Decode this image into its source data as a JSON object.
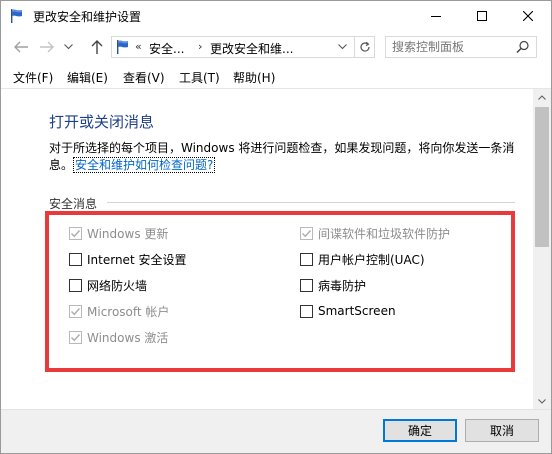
{
  "window": {
    "title": "更改安全和维护设置"
  },
  "nav": {
    "breadcrumb_prefix": "«",
    "breadcrumb_1": "安全...",
    "breadcrumb_sep": "›",
    "breadcrumb_2": "更改安全和维...",
    "search_placeholder": "搜索控制面板"
  },
  "menu": {
    "items": [
      {
        "label": "文件(F)"
      },
      {
        "label": "编辑(E)"
      },
      {
        "label": "查看(V)"
      },
      {
        "label": "工具(T)"
      },
      {
        "label": "帮助(H)"
      }
    ]
  },
  "content": {
    "heading": "打开或关闭消息",
    "desc_line1": "对于所选择的每个项目，Windows 将进行问题检查，如果发现问题，将向你发送一条消",
    "desc_line2_prefix": "息。",
    "help_link": "安全和维护如何检查问题?",
    "section_title": "安全消息"
  },
  "security_messages": {
    "left": [
      {
        "label": "Windows 更新",
        "checked": true,
        "disabled": true
      },
      {
        "label": "Internet 安全设置",
        "checked": false,
        "disabled": false
      },
      {
        "label": "网络防火墙",
        "checked": false,
        "disabled": false
      },
      {
        "label": "Microsoft 帐户",
        "checked": true,
        "disabled": true
      },
      {
        "label": "Windows 激活",
        "checked": true,
        "disabled": true
      }
    ],
    "right": [
      {
        "label": "间谍软件和垃圾软件防护",
        "checked": true,
        "disabled": true
      },
      {
        "label": "用户帐户控制(UAC)",
        "checked": false,
        "disabled": false
      },
      {
        "label": "病毒防护",
        "checked": false,
        "disabled": false
      },
      {
        "label": "SmartScreen",
        "checked": false,
        "disabled": false
      }
    ]
  },
  "footer": {
    "ok_label": "确定",
    "cancel_label": "取消"
  },
  "colors": {
    "heading": "#1e3f8a",
    "link": "#0066cc",
    "highlight_box": "#e83a3a",
    "ok_border": "#0078d7"
  }
}
